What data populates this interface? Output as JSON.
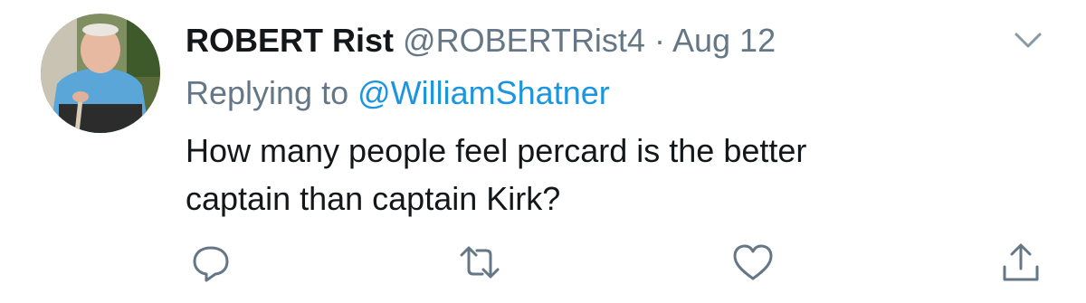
{
  "tweet": {
    "author_name": "ROBERT Rist",
    "handle": "@ROBERTRist4",
    "separator": "·",
    "date": "Aug 12",
    "replying_prefix": "Replying to",
    "reply_to": "@WilliamShatner",
    "text_line_1": "How many people feel percard is the better",
    "text_line_2": "captain than captain Kirk?"
  },
  "icons": {
    "menu": "chevron-down-icon",
    "reply": "reply-icon",
    "retweet": "retweet-icon",
    "like": "heart-icon",
    "share": "share-icon"
  },
  "colors": {
    "text_primary": "#14171a",
    "text_secondary": "#657786",
    "link": "#1b95e0",
    "icon": "#657786"
  }
}
